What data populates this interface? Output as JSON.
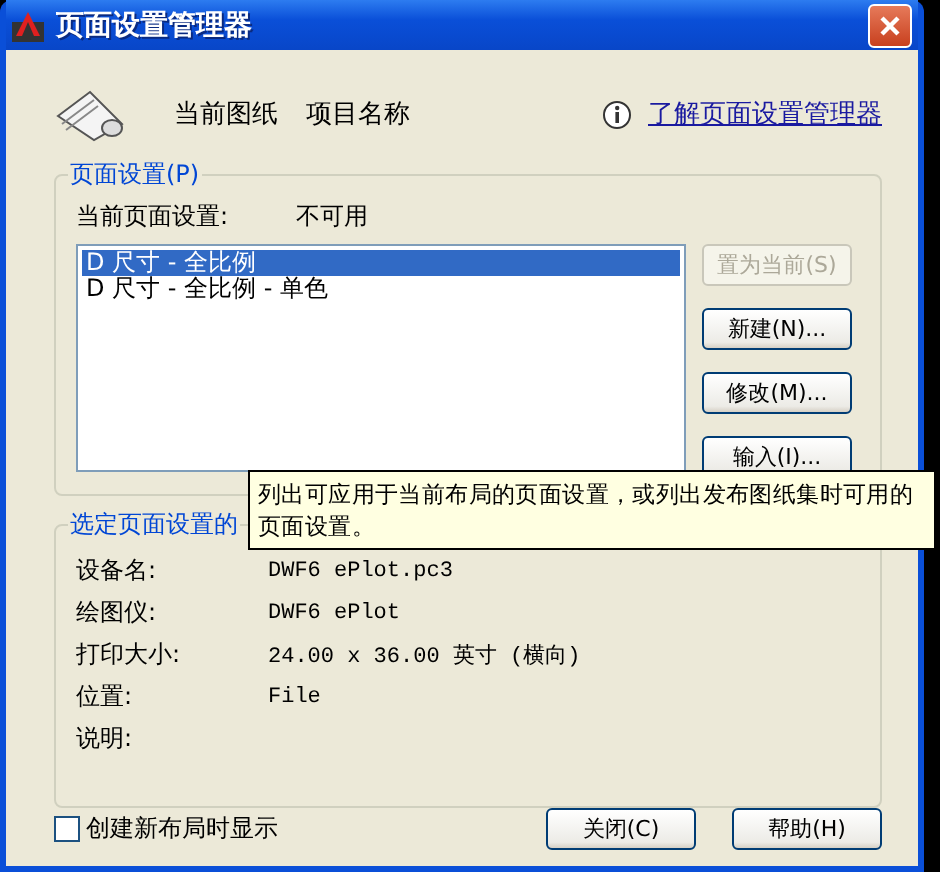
{
  "window": {
    "title": "页面设置管理器"
  },
  "header": {
    "drawing_label": "当前图纸",
    "drawing_name": "项目名称",
    "help_link": "了解页面设置管理器"
  },
  "page_setups": {
    "legend": "页面设置(P)",
    "current_label": "当前页面设置:",
    "current_value": "不可用",
    "items": [
      {
        "label": "D 尺寸 - 全比例",
        "selected": true
      },
      {
        "label": "D 尺寸 - 全比例 - 单色",
        "selected": false
      }
    ],
    "buttons": [
      {
        "label": "置为当前(S)",
        "disabled": true
      },
      {
        "label": "新建(N)...",
        "disabled": false
      },
      {
        "label": "修改(M)...",
        "disabled": false
      },
      {
        "label": "输入(I)...",
        "disabled": false
      }
    ]
  },
  "details": {
    "legend": "选定页面设置的",
    "rows": [
      {
        "label": "设备名:",
        "value": "DWF6 ePlot.pc3"
      },
      {
        "label": "绘图仪:",
        "value": "DWF6 ePlot"
      },
      {
        "label": "打印大小:",
        "value": "24.00 x 36.00 英寸 (横向)"
      },
      {
        "label": "位置:",
        "value": "File"
      },
      {
        "label": "说明:"
      }
    ]
  },
  "tooltip": "列出可应用于当前布局的页面设置，或列出发布图纸集时可用的页面设置。",
  "show_on_new_layout": {
    "label": "创建新布局时显示",
    "checked": false
  },
  "buttons": [
    "关闭(C)",
    "帮助(H)"
  ]
}
